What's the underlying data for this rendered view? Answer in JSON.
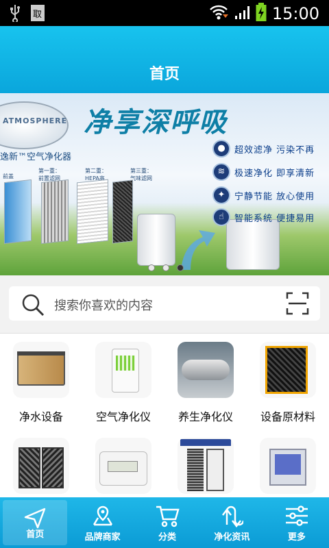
{
  "status_bar": {
    "time": "15:00"
  },
  "header": {
    "title": "首页"
  },
  "banner": {
    "brand": "ATMOSPHERE",
    "headline": "净享深呼吸",
    "subtitle": "逸新™空气净化器",
    "stages": [
      {
        "text": "前盖"
      },
      {
        "text": "第一重：\n前置滤网"
      },
      {
        "text": "第二重：\nHEPA高\n效率微粒\n滤网"
      },
      {
        "text": "第三重：\n气味滤网"
      }
    ],
    "features": [
      "超效滤净 污染不再",
      "极速净化 即享清新",
      "宁静节能 放心使用",
      "智能系统 便捷易用"
    ],
    "pager": {
      "count": 3,
      "active": 2
    }
  },
  "search": {
    "placeholder": "搜索你喜欢的内容"
  },
  "categories": [
    {
      "label": "净水设备"
    },
    {
      "label": "空气净化仪"
    },
    {
      "label": "养生净化仪"
    },
    {
      "label": "设备原材料"
    },
    {
      "label": ""
    },
    {
      "label": ""
    },
    {
      "label": ""
    },
    {
      "label": ""
    }
  ],
  "tabbar": {
    "items": [
      {
        "label": "首页",
        "icon": "send-icon"
      },
      {
        "label": "品牌商家",
        "icon": "map-icon"
      },
      {
        "label": "分类",
        "icon": "cart-icon"
      },
      {
        "label": "净化资讯",
        "icon": "swap-icon"
      },
      {
        "label": "更多",
        "icon": "sliders-icon"
      }
    ]
  },
  "colors": {
    "accent": "#0aa6dc",
    "tab_bg": "#1fb7e8"
  }
}
